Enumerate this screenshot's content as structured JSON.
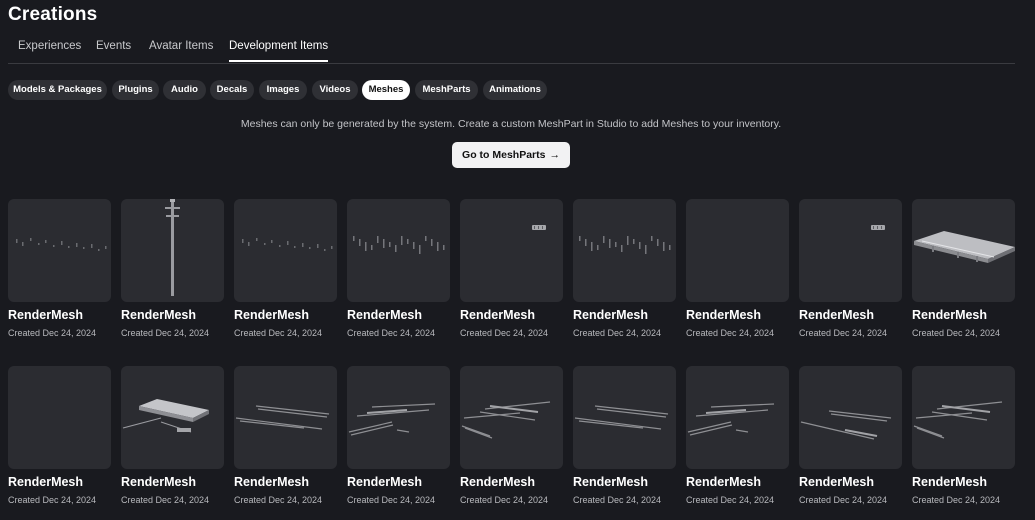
{
  "page": {
    "title": "Creations"
  },
  "tabs": [
    {
      "label": "Experiences"
    },
    {
      "label": "Events"
    },
    {
      "label": "Avatar Items"
    },
    {
      "label": "Development Items",
      "active": true
    }
  ],
  "categories": [
    {
      "label": "Models & Packages"
    },
    {
      "label": "Plugins"
    },
    {
      "label": "Audio"
    },
    {
      "label": "Decals"
    },
    {
      "label": "Images"
    },
    {
      "label": "Videos"
    },
    {
      "label": "Meshes",
      "active": true
    },
    {
      "label": "MeshParts"
    },
    {
      "label": "Animations"
    }
  ],
  "notice": {
    "text": "Meshes can only be generated by the system. Create a custom MeshPart in Studio to add Meshes to your inventory.",
    "button_label": "Go to MeshParts",
    "button_icon": "arrow-right-icon"
  },
  "items": [
    {
      "name": "RenderMesh",
      "created": "Created Dec 24, 2024",
      "thumb": "dots-low"
    },
    {
      "name": "RenderMesh",
      "created": "Created Dec 24, 2024",
      "thumb": "pole"
    },
    {
      "name": "RenderMesh",
      "created": "Created Dec 24, 2024",
      "thumb": "dots-low"
    },
    {
      "name": "RenderMesh",
      "created": "Created Dec 24, 2024",
      "thumb": "posts"
    },
    {
      "name": "RenderMesh",
      "created": "Created Dec 24, 2024",
      "thumb": "small-object"
    },
    {
      "name": "RenderMesh",
      "created": "Created Dec 24, 2024",
      "thumb": "posts"
    },
    {
      "name": "RenderMesh",
      "created": "Created Dec 24, 2024",
      "thumb": "empty"
    },
    {
      "name": "RenderMesh",
      "created": "Created Dec 24, 2024",
      "thumb": "small-object"
    },
    {
      "name": "RenderMesh",
      "created": "Created Dec 24, 2024",
      "thumb": "platform"
    },
    {
      "name": "RenderMesh",
      "created": "Created Dec 24, 2024",
      "thumb": "empty"
    },
    {
      "name": "RenderMesh",
      "created": "Created Dec 24, 2024",
      "thumb": "platform-small"
    },
    {
      "name": "RenderMesh",
      "created": "Created Dec 24, 2024",
      "thumb": "rails-2"
    },
    {
      "name": "RenderMesh",
      "created": "Created Dec 24, 2024",
      "thumb": "rails-3"
    },
    {
      "name": "RenderMesh",
      "created": "Created Dec 24, 2024",
      "thumb": "rails-4"
    },
    {
      "name": "RenderMesh",
      "created": "Created Dec 24, 2024",
      "thumb": "rails-2"
    },
    {
      "name": "RenderMesh",
      "created": "Created Dec 24, 2024",
      "thumb": "rails-3"
    },
    {
      "name": "RenderMesh",
      "created": "Created Dec 24, 2024",
      "thumb": "rails-5"
    },
    {
      "name": "RenderMesh",
      "created": "Created Dec 24, 2024",
      "thumb": "rails-4"
    }
  ]
}
